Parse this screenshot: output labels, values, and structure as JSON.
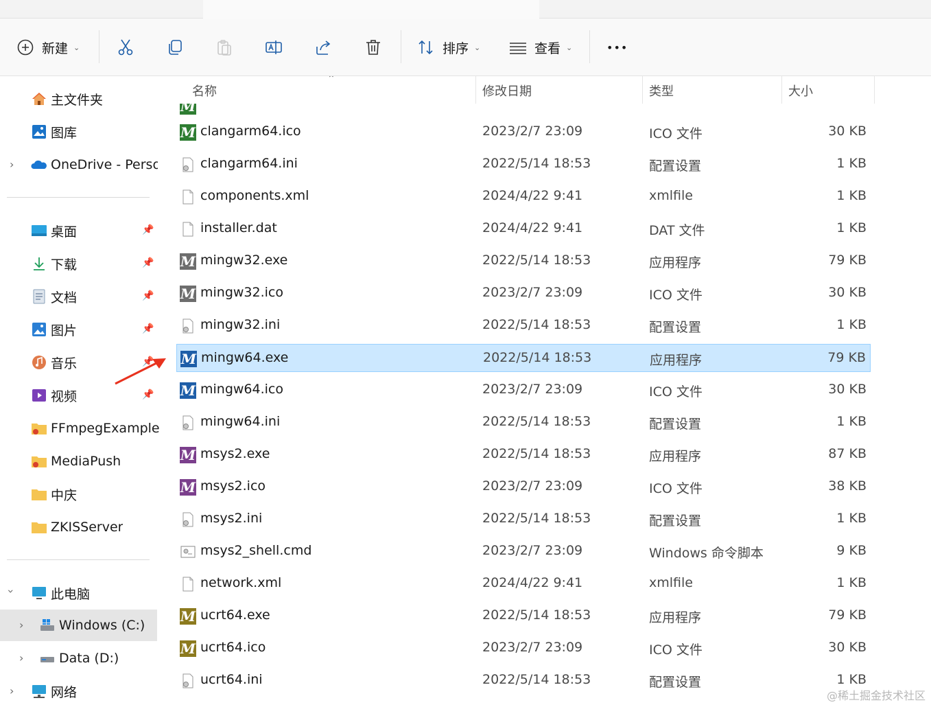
{
  "toolbar": {
    "new_label": "新建",
    "sort_label": "排序",
    "view_label": "查看",
    "more_label": "•••"
  },
  "nav": {
    "quick": [
      {
        "label": "主文件夹",
        "icon": "home-icon"
      },
      {
        "label": "图库",
        "icon": "gallery-icon"
      },
      {
        "label": "OneDrive - Persor",
        "icon": "onedrive-icon"
      }
    ],
    "pinned": [
      {
        "label": "桌面",
        "icon": "desktop-icon"
      },
      {
        "label": "下载",
        "icon": "download-icon"
      },
      {
        "label": "文档",
        "icon": "documents-icon"
      },
      {
        "label": "图片",
        "icon": "pictures-icon"
      },
      {
        "label": "音乐",
        "icon": "music-icon"
      },
      {
        "label": "视频",
        "icon": "videos-icon"
      },
      {
        "label": "FFmpegExample",
        "icon": "folder-icon"
      },
      {
        "label": "MediaPush",
        "icon": "folder-icon"
      },
      {
        "label": "中庆",
        "icon": "folder-icon"
      },
      {
        "label": "ZKISServer",
        "icon": "folder-icon"
      }
    ],
    "pc": {
      "label": "此电脑"
    },
    "drives": [
      {
        "label": "Windows (C:)"
      },
      {
        "label": "Data (D:)"
      }
    ],
    "network": {
      "label": "网络"
    }
  },
  "columns": {
    "name": "名称",
    "date": "修改日期",
    "type": "类型",
    "size": "大小"
  },
  "files": [
    {
      "name": "clangarm64.ico",
      "date": "2023/2/7 23:09",
      "type": "ICO 文件",
      "size": "30 KB",
      "icon": "m-icon",
      "color": "#2e7d32"
    },
    {
      "name": "clangarm64.ini",
      "date": "2022/5/14 18:53",
      "type": "配置设置",
      "size": "1 KB",
      "icon": "ini-icon",
      "color": ""
    },
    {
      "name": "components.xml",
      "date": "2024/4/22 9:41",
      "type": "xmlfile",
      "size": "1 KB",
      "icon": "file-icon",
      "color": ""
    },
    {
      "name": "installer.dat",
      "date": "2024/4/22 9:41",
      "type": "DAT 文件",
      "size": "1 KB",
      "icon": "file-icon",
      "color": ""
    },
    {
      "name": "mingw32.exe",
      "date": "2022/5/14 18:53",
      "type": "应用程序",
      "size": "79 KB",
      "icon": "m-icon",
      "color": "#6d6d6d"
    },
    {
      "name": "mingw32.ico",
      "date": "2023/2/7 23:09",
      "type": "ICO 文件",
      "size": "30 KB",
      "icon": "m-icon",
      "color": "#6d6d6d"
    },
    {
      "name": "mingw32.ini",
      "date": "2022/5/14 18:53",
      "type": "配置设置",
      "size": "1 KB",
      "icon": "ini-icon",
      "color": ""
    },
    {
      "name": "mingw64.exe",
      "date": "2022/5/14 18:53",
      "type": "应用程序",
      "size": "79 KB",
      "icon": "m-icon",
      "color": "#1e5ea8",
      "selected": true
    },
    {
      "name": "mingw64.ico",
      "date": "2023/2/7 23:09",
      "type": "ICO 文件",
      "size": "30 KB",
      "icon": "m-icon",
      "color": "#1e5ea8"
    },
    {
      "name": "mingw64.ini",
      "date": "2022/5/14 18:53",
      "type": "配置设置",
      "size": "1 KB",
      "icon": "ini-icon",
      "color": ""
    },
    {
      "name": "msys2.exe",
      "date": "2022/5/14 18:53",
      "type": "应用程序",
      "size": "87 KB",
      "icon": "m-icon",
      "color": "#7b3f8c"
    },
    {
      "name": "msys2.ico",
      "date": "2023/2/7 23:09",
      "type": "ICO 文件",
      "size": "38 KB",
      "icon": "m-icon",
      "color": "#7b3f8c"
    },
    {
      "name": "msys2.ini",
      "date": "2022/5/14 18:53",
      "type": "配置设置",
      "size": "1 KB",
      "icon": "ini-icon",
      "color": ""
    },
    {
      "name": "msys2_shell.cmd",
      "date": "2023/2/7 23:09",
      "type": "Windows 命令脚本",
      "size": "9 KB",
      "icon": "cmd-icon",
      "color": ""
    },
    {
      "name": "network.xml",
      "date": "2024/4/22 9:41",
      "type": "xmlfile",
      "size": "1 KB",
      "icon": "file-icon",
      "color": ""
    },
    {
      "name": "ucrt64.exe",
      "date": "2022/5/14 18:53",
      "type": "应用程序",
      "size": "79 KB",
      "icon": "m-icon",
      "color": "#8c7a1e"
    },
    {
      "name": "ucrt64.ico",
      "date": "2023/2/7 23:09",
      "type": "ICO 文件",
      "size": "30 KB",
      "icon": "m-icon",
      "color": "#8c7a1e"
    },
    {
      "name": "ucrt64.ini",
      "date": "2022/5/14 18:53",
      "type": "配置设置",
      "size": "1 KB",
      "icon": "ini-icon",
      "color": ""
    }
  ],
  "watermark": "@稀土掘金技术社区"
}
